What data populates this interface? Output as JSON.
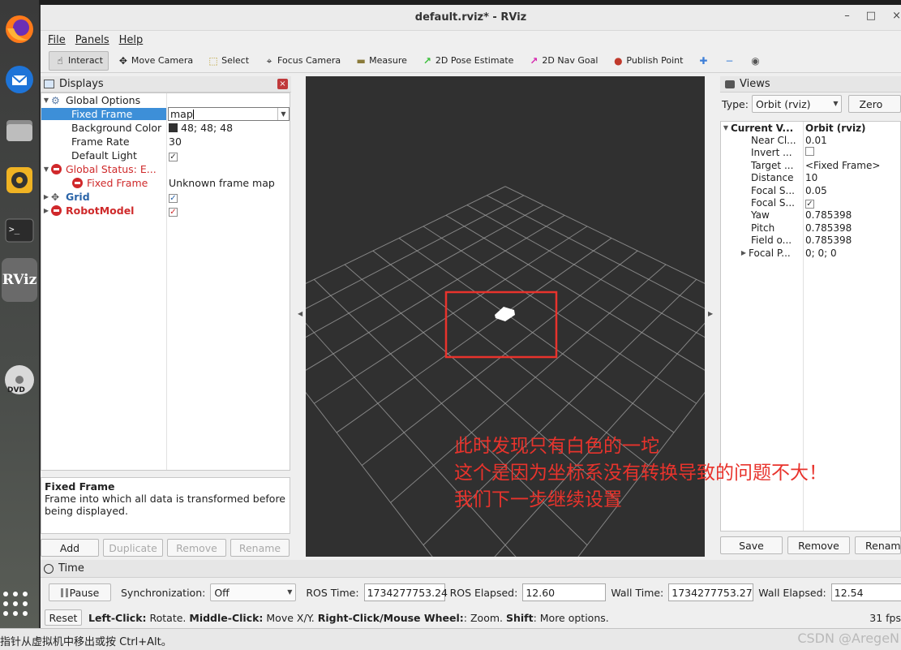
{
  "window": {
    "title": "default.rviz* - RViz",
    "controls": [
      "–",
      "□",
      "×"
    ]
  },
  "menu": [
    "File",
    "Panels",
    "Help"
  ],
  "toolbar": [
    {
      "label": "Interact",
      "icon": "hand-icon",
      "glyph": "☝",
      "active": true
    },
    {
      "label": "Move Camera",
      "icon": "move-camera-icon",
      "glyph": "✥"
    },
    {
      "label": "Select",
      "icon": "select-icon",
      "glyph": "⬚"
    },
    {
      "label": "Focus Camera",
      "icon": "focus-camera-icon",
      "glyph": "⌖"
    },
    {
      "label": "Measure",
      "icon": "ruler-icon",
      "glyph": "▬"
    },
    {
      "label": "2D Pose Estimate",
      "icon": "pose-estimate-arrow-icon",
      "glyph": "↗",
      "color": "#3cbf3c"
    },
    {
      "label": "2D Nav Goal",
      "icon": "nav-goal-arrow-icon",
      "glyph": "↗",
      "color": "#d62ab0"
    },
    {
      "label": "Publish Point",
      "icon": "map-pin-icon",
      "glyph": "●",
      "color": "#c0392b"
    }
  ],
  "toolbar_extra": [
    {
      "icon": "plus-icon",
      "glyph": "✚"
    },
    {
      "icon": "minus-icon",
      "glyph": "−"
    },
    {
      "icon": "eye-icon",
      "glyph": "◉"
    }
  ],
  "displays": {
    "title": "Displays",
    "rows": [
      {
        "label": "Global Options",
        "value": ""
      },
      {
        "label": "Fixed Frame",
        "value": "map"
      },
      {
        "label": "Background Color",
        "value": "48; 48; 48"
      },
      {
        "label": "Frame Rate",
        "value": "30"
      },
      {
        "label": "Default Light",
        "value": "✓"
      },
      {
        "label": "Global Status: E...",
        "value": ""
      },
      {
        "label": "Fixed Frame",
        "value": "Unknown frame map"
      },
      {
        "label": "Grid",
        "value": "✓"
      },
      {
        "label": "RobotModel",
        "value": "✓"
      }
    ],
    "description": {
      "title": "Fixed Frame",
      "text": "Frame into which all data is transformed before being displayed."
    },
    "buttons": [
      "Add",
      "Duplicate",
      "Remove",
      "Rename"
    ]
  },
  "views": {
    "title": "Views",
    "type_label": "Type:",
    "type_value": "Orbit (rviz)",
    "zero_label": "Zero",
    "rows": [
      {
        "label": "Current V...",
        "value": "Orbit (rviz)"
      },
      {
        "label": "Near Cl...",
        "value": "0.01"
      },
      {
        "label": "Invert ...",
        "value": ""
      },
      {
        "label": "Target ...",
        "value": "<Fixed Frame>"
      },
      {
        "label": "Distance",
        "value": "10"
      },
      {
        "label": "Focal S...",
        "value": "0.05"
      },
      {
        "label": "Focal S...",
        "value": "✓"
      },
      {
        "label": "Yaw",
        "value": "0.785398"
      },
      {
        "label": "Pitch",
        "value": "0.785398"
      },
      {
        "label": "Field o...",
        "value": "0.785398"
      },
      {
        "label": "Focal P...",
        "value": "0; 0; 0"
      }
    ],
    "buttons": [
      "Save",
      "Remove",
      "Rename"
    ]
  },
  "time": {
    "title": "Time",
    "pause_label": "Pause",
    "sync_label": "Synchronization:",
    "sync_value": "Off",
    "ros_time_label": "ROS Time:",
    "ros_time": "1734277753.24",
    "ros_elapsed_label": "ROS Elapsed:",
    "ros_elapsed": "12.60",
    "wall_time_label": "Wall Time:",
    "wall_time": "1734277753.27",
    "wall_elapsed_label": "Wall Elapsed:",
    "wall_elapsed": "12.54",
    "reset_label": "Reset",
    "status": [
      {
        "key": "Left-Click:",
        "text": " Rotate. "
      },
      {
        "key": "Middle-Click:",
        "text": " Move X/Y. "
      },
      {
        "key": "Right-Click/Mouse Wheel:",
        "text": ": Zoom. "
      },
      {
        "key": "Shift",
        "text": ": More options."
      }
    ],
    "fps": "31 fps"
  },
  "annotation": {
    "lines": [
      "此时发现只有白色的一坨",
      "这个是因为坐标系没有转换导致的问题不大！",
      "我们下一步继续设置"
    ],
    "color": "#e8332c"
  },
  "bottom": {
    "hint": "指针从虚拟机中移出或按 Ctrl+Alt。",
    "watermark": "CSDN @AregeN"
  },
  "dock": {
    "rviz_label": "RViz",
    "dvd_label": "DVD"
  },
  "colors": {
    "selection": "#3d8fd8",
    "error": "#cf2a2b",
    "viewport_bg": "#303030"
  }
}
